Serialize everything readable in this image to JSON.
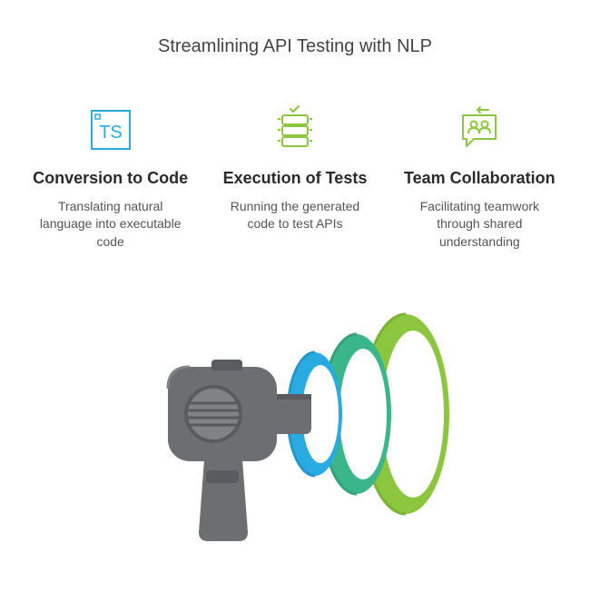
{
  "title": "Streamlining API Testing with NLP",
  "columns": [
    {
      "heading": "Conversion to Code",
      "desc": "Translating natural language into executable code",
      "icon": "ts-icon",
      "color": "#29abe2"
    },
    {
      "heading": "Execution of Tests",
      "desc": "Running the generated code to test APIs",
      "icon": "server-icon",
      "color": "#8cc63f"
    },
    {
      "heading": "Team Collaboration",
      "desc": "Facilitating teamwork through shared understanding",
      "icon": "chat-icon",
      "color": "#8cc63f"
    }
  ],
  "illustration": {
    "name": "megaphone-rings",
    "ring_colors": [
      "#29abe2",
      "#3bb58a",
      "#8cc63f"
    ],
    "body_color": "#6d6e71"
  }
}
